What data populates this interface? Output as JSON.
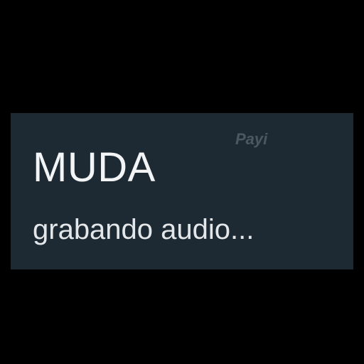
{
  "header": {
    "contact_name": "MUDA",
    "status": "grabando audio...",
    "watermark": "Payi"
  },
  "colors": {
    "background": "#000000",
    "card": "#1e2a33",
    "name_text": "#f2f4f5",
    "status_text": "#e3e7ea",
    "watermark": "#4a5861"
  }
}
